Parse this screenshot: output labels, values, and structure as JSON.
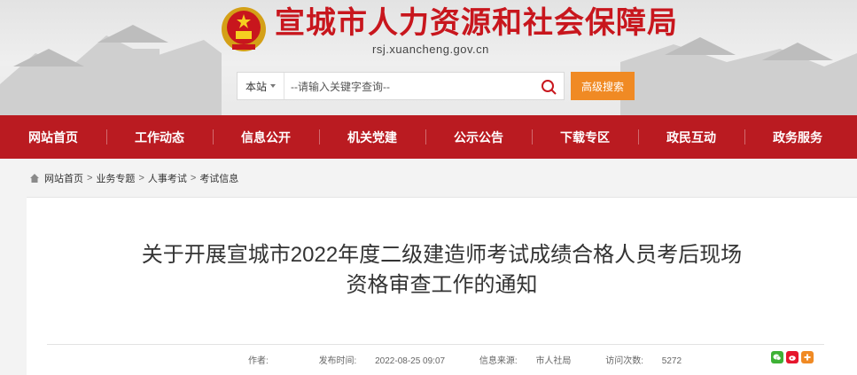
{
  "header": {
    "site_title": "宣城市人力资源和社会保障局",
    "domain": "rsj.xuancheng.gov.cn",
    "colors": {
      "title": "#c8161d",
      "nav": "#ba1b21",
      "accent": "#f08a24"
    }
  },
  "search": {
    "scope": "本站",
    "placeholder": "--请输入关键字查询--",
    "button_icon": "search-icon",
    "advanced_label": "高级搜索"
  },
  "nav": {
    "items": [
      {
        "label": "网站首页"
      },
      {
        "label": "工作动态"
      },
      {
        "label": "信息公开"
      },
      {
        "label": "机关党建"
      },
      {
        "label": "公示公告"
      },
      {
        "label": "下载专区"
      },
      {
        "label": "政民互动"
      },
      {
        "label": "政务服务"
      }
    ]
  },
  "breadcrumb": {
    "icon": "home-icon",
    "items": [
      "网站首页",
      "业务专题",
      "人事考试",
      "考试信息"
    ],
    "separator": ">"
  },
  "article": {
    "title_line1": "关于开展宣城市2022年度二级建造师考试成绩合格人员考后现场",
    "title_line2": "资格审查工作的通知",
    "meta": {
      "author_label": "作者:",
      "author": "",
      "date_label": "发布时间:",
      "date": "2022-08-25 09:07",
      "source_label": "信息来源:",
      "source": "市人社局",
      "views_label": "访问次数:",
      "views": "5272"
    },
    "share_icons": [
      "wechat-icon",
      "weibo-icon",
      "share-plus-icon"
    ]
  }
}
